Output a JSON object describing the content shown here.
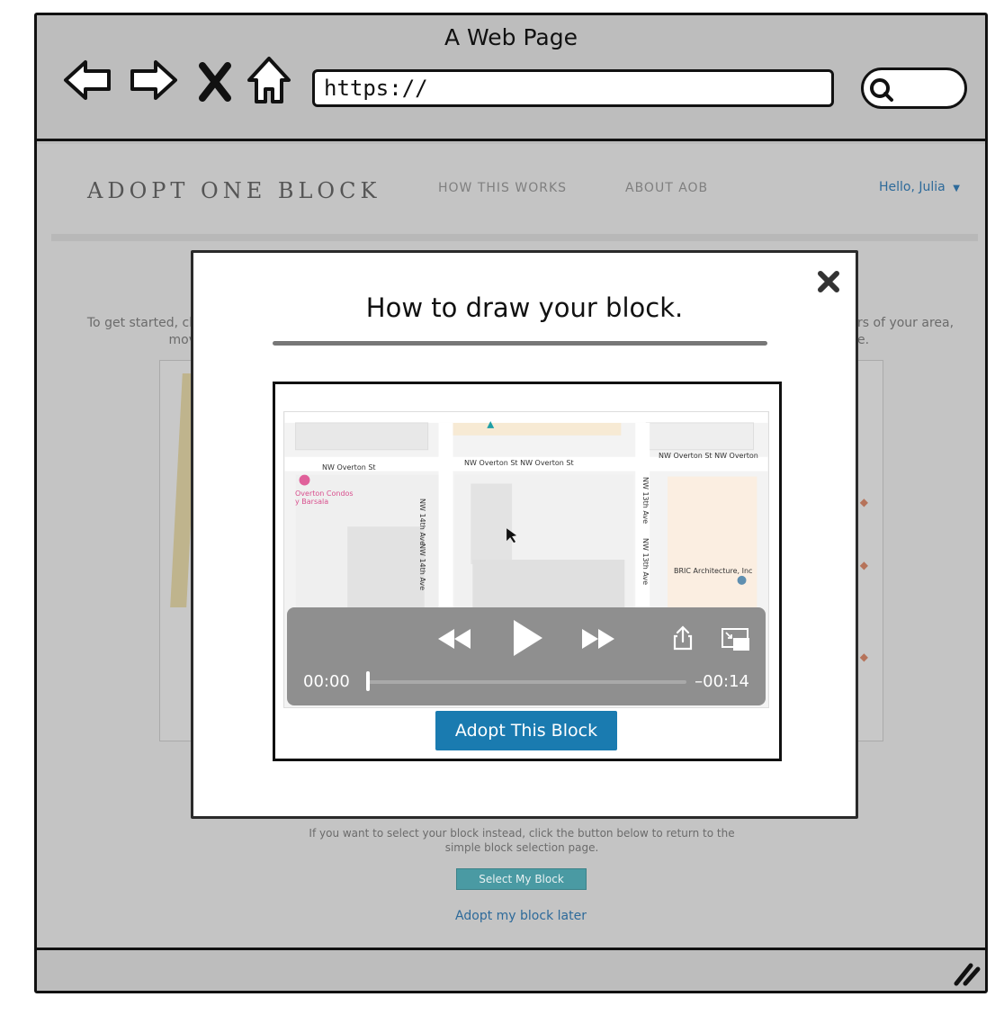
{
  "browser": {
    "window_title": "A Web Page",
    "url": "https://",
    "icons": [
      "back-icon",
      "forward-icon",
      "close-icon",
      "home-icon",
      "search-icon",
      "resize-icon"
    ]
  },
  "site": {
    "brand": "ADOPT ONE BLOCK",
    "nav": [
      "HOW THIS WORKS",
      "ABOUT AOB"
    ],
    "greeting": "Hello, Julia",
    "intro_left": [
      "To get started, cli",
      "mov"
    ],
    "intro_right": [
      "rs of your area,",
      "e."
    ],
    "below_text": "If you want to select your block instead, click the button below to return to the simple block selection page.",
    "select_button": "Select My Block",
    "later_link": "Adopt my block later"
  },
  "modal": {
    "title": "How to draw your block.",
    "adopt_button": "Adopt This Block",
    "video": {
      "time_elapsed": "00:00",
      "time_remaining": "–00:14",
      "progress": 0.0
    },
    "map_labels": {
      "street_1": "NW Overton St",
      "street_2": "NW Overton St  NW Overton St",
      "street_3": "NW Overton St  NW Overton",
      "ave_1a": "NW 14th Ave",
      "ave_1b": "NW 14th Ave",
      "ave_2a": "NW 13th Ave",
      "ave_2b": "NW 13th Ave",
      "poi_1a": "Overton Condos",
      "poi_1b": "y Barsala",
      "poi_2": "BRIC Architecture, Inc"
    }
  },
  "colors": {
    "accent": "#1a7bb0",
    "teal_button": "#4a9aa3",
    "link": "#2d6a9a",
    "frame_gray": "#bdbdbd"
  }
}
